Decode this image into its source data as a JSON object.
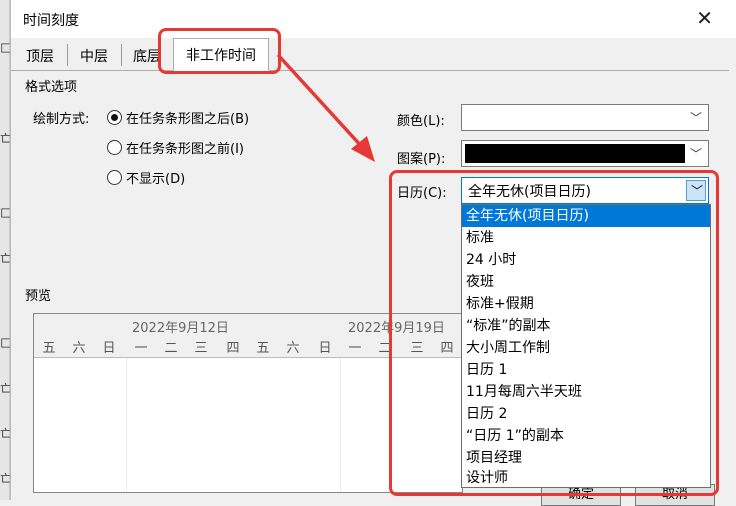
{
  "background_app": {
    "glyphs": [
      "匚",
      "亡",
      "匚",
      "亡",
      "匚",
      "亡",
      "亡",
      "亡"
    ]
  },
  "dialog": {
    "title": "时间刻度",
    "close_glyph": "✕"
  },
  "tabs": [
    {
      "label": "顶层",
      "active": false
    },
    {
      "label": "中层",
      "active": false
    },
    {
      "label": "底层",
      "active": false
    },
    {
      "label": "非工作时间",
      "active": true
    }
  ],
  "format": {
    "group_label": "格式选项",
    "draw_label": "绘制方式:",
    "radios": [
      {
        "label": "在任务条形图之后(B)",
        "checked": true
      },
      {
        "label": "在任务条形图之前(I)",
        "checked": false
      },
      {
        "label": "不显示(D)",
        "checked": false
      }
    ],
    "color_label": "颜色(L):",
    "color_value": "",
    "pattern_label": "图案(P):",
    "pattern_color": "#000000",
    "calendar_label": "日历(C):",
    "calendar_value": "全年无休(项目日历)"
  },
  "calendar_options": [
    "全年无休(项目日历)",
    "标准",
    "24 小时",
    "夜班",
    "标准+假期",
    "“标准”的副本",
    "大小周工作制",
    "日历 1",
    "11月每周六半天班",
    "日历 2",
    "“日历 1”的副本",
    "项目经理",
    "设计师"
  ],
  "preview": {
    "label": "预览",
    "week1": "2022年9月12日",
    "week2": "2022年9月19日",
    "days": [
      "五",
      "六",
      "日",
      "一",
      "二",
      "三",
      "四",
      "五",
      "六",
      "日",
      "一",
      "二",
      "三",
      "四"
    ]
  },
  "buttons": {
    "ok": "确定",
    "cancel": "取消"
  },
  "colors": {
    "highlight": "#e53935",
    "selection": "#0078d7"
  }
}
